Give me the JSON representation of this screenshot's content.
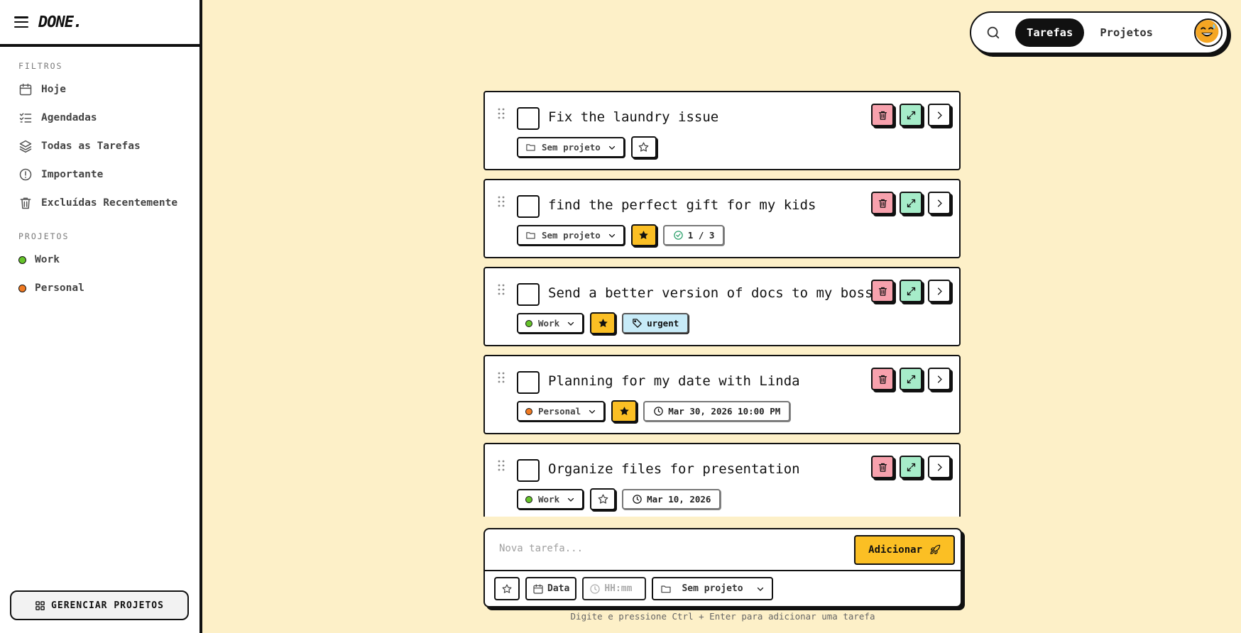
{
  "app": {
    "logo": "DONE."
  },
  "sidebar": {
    "filters_title": "FILTROS",
    "filters": [
      {
        "label": "Hoje",
        "icon": "calendar-icon"
      },
      {
        "label": "Agendadas",
        "icon": "list-checks-icon"
      },
      {
        "label": "Todas as Tarefas",
        "icon": "layers-icon"
      },
      {
        "label": "Importante",
        "icon": "alert-circle-icon"
      },
      {
        "label": "Excluídas Recentemente",
        "icon": "trash-icon"
      }
    ],
    "projects_title": "PROJETOS",
    "projects": [
      {
        "label": "Work",
        "color": "#65c32a"
      },
      {
        "label": "Personal",
        "color": "#f07a22"
      }
    ],
    "manage_label": "GERENCIAR PROJETOS"
  },
  "topnav": {
    "tabs": [
      "Tarefas",
      "Projetos"
    ],
    "active_tab": "Tarefas"
  },
  "tasks": [
    {
      "title": "Fix the laundry issue",
      "project": "Sem projeto",
      "project_color": null,
      "starred": false,
      "extra": null
    },
    {
      "title": "find the perfect gift for my kids",
      "project": "Sem projeto",
      "project_color": null,
      "starred": true,
      "extra": {
        "type": "subtasks",
        "text": "1 / 3"
      }
    },
    {
      "title": "Send a better version of docs to my boss",
      "project": "Work",
      "project_color": "#65c32a",
      "starred": true,
      "extra": {
        "type": "tag",
        "text": "urgent"
      }
    },
    {
      "title": "Planning for my date with Linda",
      "project": "Personal",
      "project_color": "#f07a22",
      "starred": true,
      "extra": {
        "type": "date",
        "text": "Mar 30, 2026 10:00 PM"
      }
    },
    {
      "title": "Organize files for presentation",
      "project": "Work",
      "project_color": "#65c32a",
      "starred": false,
      "extra": {
        "type": "date",
        "text": "Mar 10, 2026"
      }
    }
  ],
  "composer": {
    "placeholder": "Nova tarefa...",
    "add_label": "Adicionar",
    "date_label": "Data",
    "time_placeholder": "HH:mm",
    "project_label": "Sem projeto",
    "hint": "Digite e pressione Ctrl + Enter para adicionar uma tarefa"
  },
  "colors": {
    "background": "#fdf0c8",
    "accent": "#fbbf24",
    "delete": "#f7a1ad",
    "expand": "#a6ecc9",
    "tag": "#c7ebf8"
  }
}
